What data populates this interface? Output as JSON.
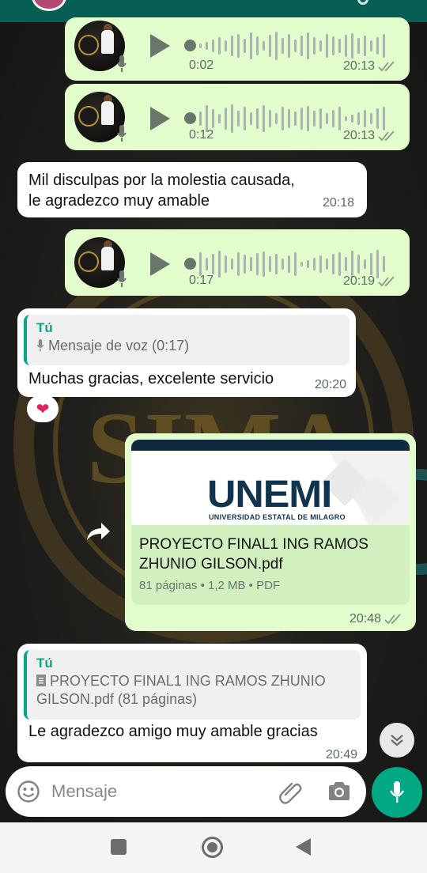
{
  "messages": [
    {
      "type": "voice",
      "direction": "out",
      "duration": "0:02",
      "time": "20:13",
      "status": "read"
    },
    {
      "type": "voice",
      "direction": "out",
      "duration": "0:12",
      "time": "20:13",
      "status": "read"
    },
    {
      "type": "text",
      "direction": "in",
      "text": "Mil disculpas por la molestia causada, le agradezco muy amable",
      "time": "20:18"
    },
    {
      "type": "voice",
      "direction": "out",
      "duration": "0:17",
      "time": "20:19",
      "status": "read"
    },
    {
      "type": "reply",
      "direction": "in",
      "quote_author": "Tú",
      "quote_snippet": "Mensaje de voz (0:17)",
      "text": "Muchas gracias, excelente servicio",
      "time": "20:20",
      "reaction": "❤"
    },
    {
      "type": "document",
      "direction": "out",
      "preview_brand": "UNEMI",
      "preview_subtitle": "UNIVERSIDAD ESTATAL DE MILAGRO",
      "file_name": "PROYECTO FINAL1 ING RAMOS ZHUNIO GILSON.pdf",
      "file_meta": "81 páginas • 1,2 MB • PDF",
      "time": "20:48",
      "status": "read"
    },
    {
      "type": "reply",
      "direction": "in",
      "quote_author": "Tú",
      "quote_snippet": "PROYECTO FINAL1 ING RAMOS ZHUNIO GILSON.pdf (81 páginas)",
      "text": "Le agradezco amigo muy amable gracias",
      "time": "20:49"
    }
  ],
  "composer": {
    "placeholder": "Mensaje"
  },
  "colors": {
    "header": "#075e54",
    "outgoing": "#e2fdcb",
    "incoming": "#ffffff",
    "accent": "#00a884"
  },
  "icons": [
    "play-icon",
    "mic-icon",
    "double-check-icon",
    "forward-icon",
    "emoji-icon",
    "attach-icon",
    "camera-icon",
    "chevron-down-icon",
    "heart-icon",
    "document-icon"
  ]
}
